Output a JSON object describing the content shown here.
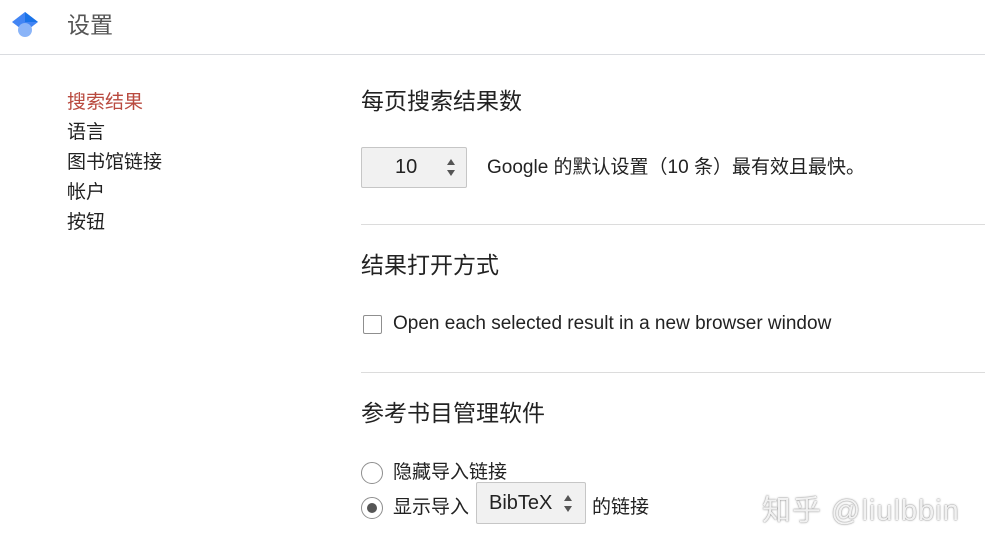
{
  "header": {
    "title": "设置",
    "logo_icon": "scholar-cap-logo-icon"
  },
  "sidebar": {
    "items": [
      {
        "label": "搜索结果",
        "active": true
      },
      {
        "label": "语言",
        "active": false
      },
      {
        "label": "图书馆链接",
        "active": false
      },
      {
        "label": "帐户",
        "active": false
      },
      {
        "label": "按钮",
        "active": false
      }
    ]
  },
  "results_per_page": {
    "title": "每页搜索结果数",
    "selected_value": "10",
    "description": "Google 的默认设置（10 条）最有效且最快。"
  },
  "open_results": {
    "title": "结果打开方式",
    "checkbox_label": "Open each selected result in a new browser window",
    "checked": false
  },
  "citation_manager": {
    "title": "参考书目管理软件",
    "hide_option_label": "隐藏导入链接",
    "show_option_prefix": "显示导入",
    "selected_format": "BibTeX",
    "show_option_suffix": "的链接",
    "selected_option": "show"
  },
  "watermark": "知乎 @liulbbin",
  "colors": {
    "active_nav": "#b94a3f",
    "logo_blue": "#4285f4",
    "divider": "#dcdcdc"
  }
}
